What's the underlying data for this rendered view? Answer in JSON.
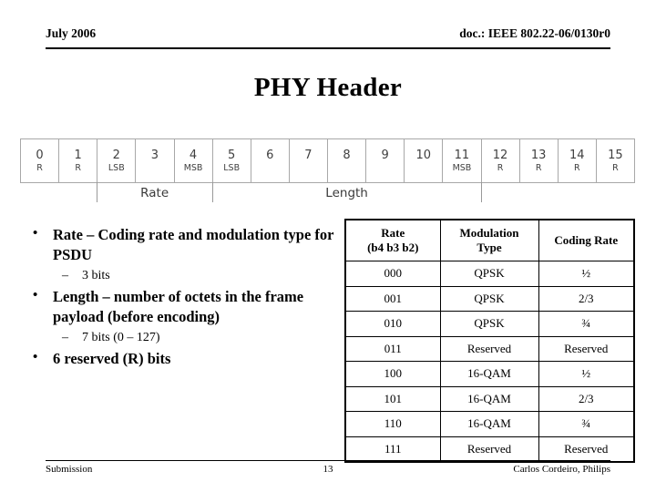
{
  "header": {
    "date": "July 2006",
    "doc": "doc.: IEEE 802.22-06/0130r0"
  },
  "title": "PHY Header",
  "bitfield": {
    "cells": [
      {
        "num": "0",
        "sub": "R"
      },
      {
        "num": "1",
        "sub": "R"
      },
      {
        "num": "2",
        "sub": "LSB"
      },
      {
        "num": "3",
        "sub": ""
      },
      {
        "num": "4",
        "sub": "MSB"
      },
      {
        "num": "5",
        "sub": "LSB"
      },
      {
        "num": "6",
        "sub": ""
      },
      {
        "num": "7",
        "sub": ""
      },
      {
        "num": "8",
        "sub": ""
      },
      {
        "num": "9",
        "sub": ""
      },
      {
        "num": "10",
        "sub": ""
      },
      {
        "num": "11",
        "sub": "MSB"
      },
      {
        "num": "12",
        "sub": "R"
      },
      {
        "num": "13",
        "sub": "R"
      },
      {
        "num": "14",
        "sub": "R"
      },
      {
        "num": "15",
        "sub": "R"
      }
    ],
    "spans": [
      {
        "label": "Rate"
      },
      {
        "label": "Length"
      }
    ]
  },
  "bullets": [
    {
      "level": 1,
      "text": "Rate – Coding rate and modulation type for PSDU"
    },
    {
      "level": 2,
      "text": "3 bits"
    },
    {
      "level": 1,
      "text": "Length – number of octets in the frame payload (before encoding)"
    },
    {
      "level": 2,
      "text": "7 bits (0 – 127)"
    },
    {
      "level": 1,
      "text": "6 reserved (R) bits"
    }
  ],
  "rate_table": {
    "headers": [
      {
        "line1": "Rate",
        "line2": "(b4 b3 b2)"
      },
      {
        "line1": "Modulation",
        "line2": "Type"
      },
      {
        "line1": "Coding Rate",
        "line2": ""
      }
    ],
    "rows": [
      [
        "000",
        "QPSK",
        "½"
      ],
      [
        "001",
        "QPSK",
        "2/3"
      ],
      [
        "010",
        "QPSK",
        "¾"
      ],
      [
        "011",
        "Reserved",
        "Reserved"
      ],
      [
        "100",
        "16-QAM",
        "½"
      ],
      [
        "101",
        "16-QAM",
        "2/3"
      ],
      [
        "110",
        "16-QAM",
        "¾"
      ],
      [
        "111",
        "Reserved",
        "Reserved"
      ]
    ]
  },
  "footer": {
    "left": "Submission",
    "page": "13",
    "right": "Carlos Cordeiro, Philips"
  }
}
